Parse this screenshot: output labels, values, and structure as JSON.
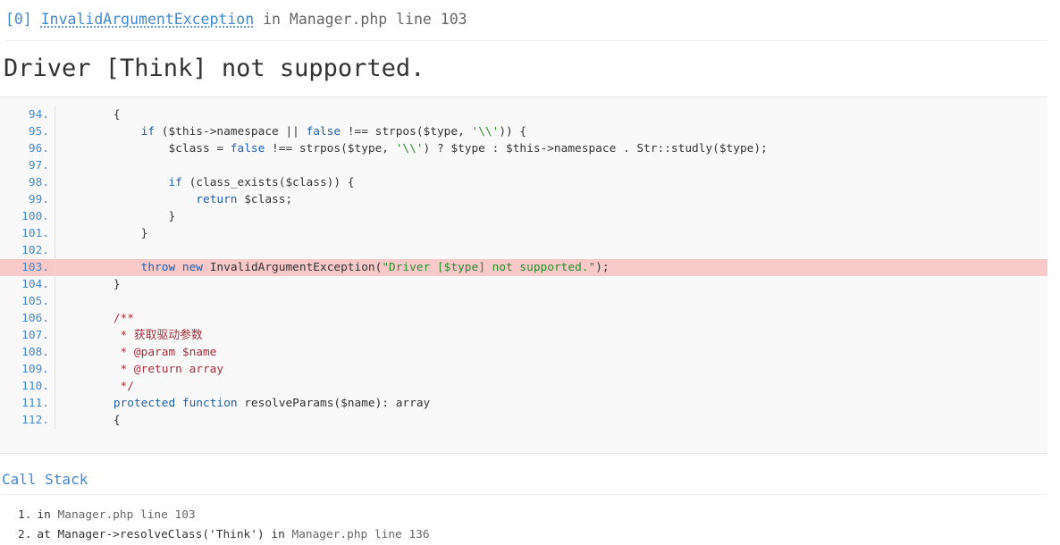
{
  "header": {
    "index": "[0]",
    "exception_class": "InvalidArgumentException",
    "in_word": "in",
    "file_line": "Manager.php line 103"
  },
  "message": "Driver [Think] not supported.",
  "source": {
    "lines": [
      {
        "no": "94.",
        "code": "    {"
      },
      {
        "no": "95.",
        "code": "        if ($this->namespace || false !== strpos($type, '\\\\')) {"
      },
      {
        "no": "96.",
        "code": "            $class = false !== strpos($type, '\\\\') ? $type : $this->namespace . Str::studly($type);"
      },
      {
        "no": "97.",
        "code": ""
      },
      {
        "no": "98.",
        "code": "            if (class_exists($class)) {"
      },
      {
        "no": "99.",
        "code": "                return $class;"
      },
      {
        "no": "100.",
        "code": "            }"
      },
      {
        "no": "101.",
        "code": "        }"
      },
      {
        "no": "102.",
        "code": ""
      },
      {
        "no": "103.",
        "code": "        throw new InvalidArgumentException(\"Driver [$type] not supported.\");",
        "highlight": true
      },
      {
        "no": "104.",
        "code": "    }"
      },
      {
        "no": "105.",
        "code": ""
      },
      {
        "no": "106.",
        "code": "    /**"
      },
      {
        "no": "107.",
        "code": "     * 获取驱动参数"
      },
      {
        "no": "108.",
        "code": "     * @param $name"
      },
      {
        "no": "109.",
        "code": "     * @return array"
      },
      {
        "no": "110.",
        "code": "     */"
      },
      {
        "no": "111.",
        "code": "    protected function resolveParams($name): array"
      },
      {
        "no": "112.",
        "code": "    {"
      }
    ]
  },
  "callstack": {
    "title": "Call Stack",
    "items": [
      {
        "idx": "1.",
        "prefix": "in",
        "file": "Manager.php line 103"
      },
      {
        "idx": "2.",
        "prefix": "at Manager->resolveClass('Think') in",
        "file": "Manager.php line 136"
      }
    ]
  }
}
